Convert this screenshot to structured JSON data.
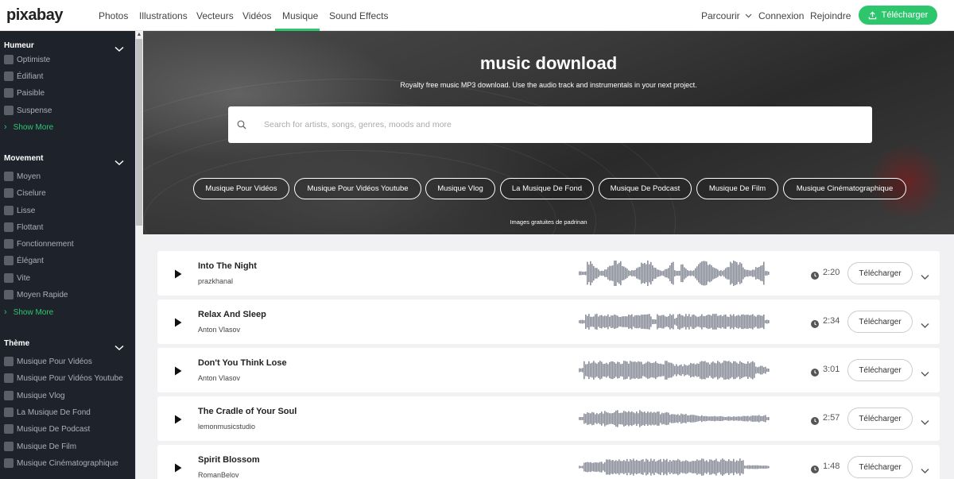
{
  "brand": {
    "logo": "pixabay",
    "accent": "#2ec66d"
  },
  "nav": {
    "items": [
      "Photos",
      "Illustrations",
      "Vecteurs",
      "Vidéos",
      "Musique",
      "Sound Effects"
    ],
    "active": "Musique",
    "browse": "Parcourir",
    "login": "Connexion",
    "join": "Rejoindre",
    "upload": "Télécharger"
  },
  "sidebar": {
    "sections": [
      {
        "title": "Humeur",
        "items": [
          "Optimiste",
          "Édifiant",
          "Paisible",
          "Suspense"
        ],
        "show_more": "Show More"
      },
      {
        "title": "Movement",
        "items": [
          "Moyen",
          "Ciselure",
          "Lisse",
          "Flottant",
          "Fonctionnement",
          "Élégant",
          "Vite",
          "Moyen Rapide"
        ],
        "show_more": "Show More"
      },
      {
        "title": "Thème",
        "items": [
          "Musique Pour Vidéos",
          "Musique Pour Vidéos Youtube",
          "Musique Vlog",
          "La Musique De Fond",
          "Musique De Podcast",
          "Musique De Film",
          "Musique Cinématographique"
        ]
      }
    ]
  },
  "hero": {
    "title": "music download",
    "subtitle": "Royalty free music MP3 download. Use the audio track and instrumentals in your next project.",
    "search_placeholder": "Search for artists, songs, genres, moods and more",
    "tags": [
      "Musique Pour Vidéos",
      "Musique Pour Vidéos Youtube",
      "Musique Vlog",
      "La Musique De Fond",
      "Musique De Podcast",
      "Musique De Film",
      "Musique Cinématographique"
    ],
    "credit": "Images gratuites de padrinan"
  },
  "tracks": [
    {
      "title": "Into The Night",
      "artist": "prazkhanal",
      "duration": "2:20",
      "download": "Télécharger"
    },
    {
      "title": "Relax And Sleep",
      "artist": "Anton Vlasov",
      "duration": "2:34",
      "download": "Télécharger"
    },
    {
      "title": "Don't You Think Lose",
      "artist": "Anton Vlasov",
      "duration": "3:01",
      "download": "Télécharger"
    },
    {
      "title": "The Cradle of Your Soul",
      "artist": "lemonmusicstudio",
      "duration": "2:57",
      "download": "Télécharger"
    },
    {
      "title": "Spirit Blossom",
      "artist": "RomanBelov",
      "duration": "1:48",
      "download": "Télécharger"
    }
  ]
}
